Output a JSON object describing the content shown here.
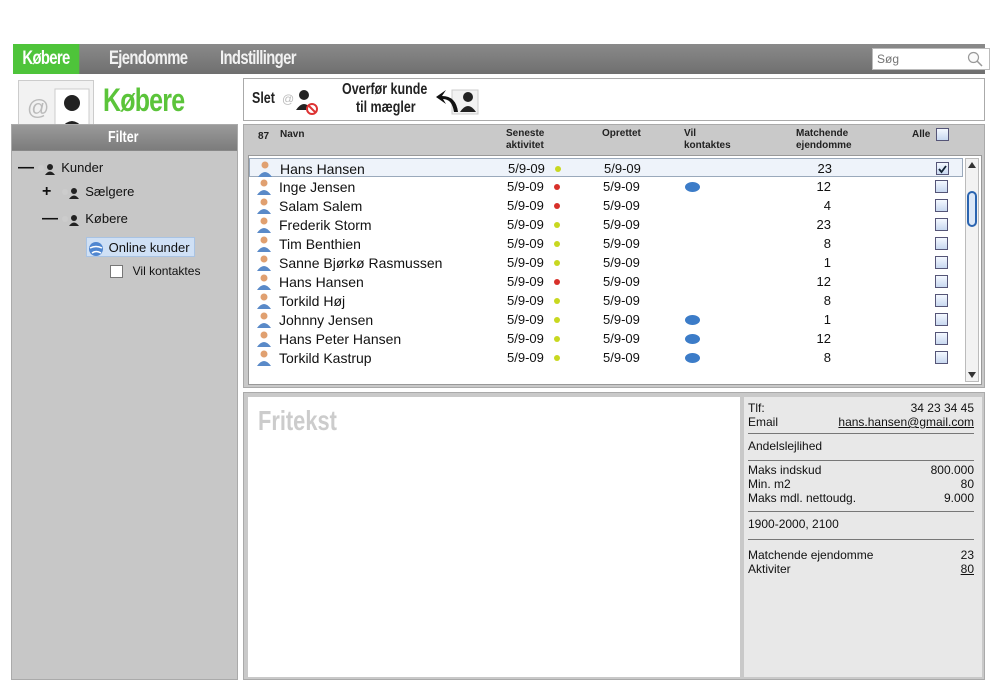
{
  "nav": {
    "tabs": [
      {
        "label": "Købere",
        "active": true
      },
      {
        "label": "Ejendomme",
        "active": false
      },
      {
        "label": "Indstillinger",
        "active": false
      }
    ],
    "search_placeholder": "Søg"
  },
  "page": {
    "title": "Købere"
  },
  "filter": {
    "title": "Filter",
    "tree": {
      "root": "Kunder",
      "sellers": "Sælgere",
      "buyers": "Købere",
      "online": "Online kunder",
      "contact": "Vil kontaktes"
    }
  },
  "toolbar": {
    "delete_label": "Slet",
    "transfer_line1": "Overfør kunde",
    "transfer_line2": "til mægler"
  },
  "grid": {
    "count": "87",
    "headers": {
      "name": "Navn",
      "latest1": "Seneste",
      "latest2": "aktivitet",
      "created": "Oprettet",
      "contact1": "Vil",
      "contact2": "kontaktes",
      "matching1": "Matchende",
      "matching2": "ejendomme",
      "all": "Alle"
    },
    "rows": [
      {
        "name": "Hans Hansen",
        "activity": "5/9-09",
        "status": "yellow",
        "created": "5/9-09",
        "contact": false,
        "matching": "23",
        "checked": true
      },
      {
        "name": "Inge Jensen",
        "activity": "5/9-09",
        "status": "red",
        "created": "5/9-09",
        "contact": true,
        "matching": "12",
        "checked": false
      },
      {
        "name": "Salam Salem",
        "activity": "5/9-09",
        "status": "red",
        "created": "5/9-09",
        "contact": false,
        "matching": "4",
        "checked": false
      },
      {
        "name": "Frederik Storm",
        "activity": "5/9-09",
        "status": "yellow",
        "created": "5/9-09",
        "contact": false,
        "matching": "23",
        "checked": false
      },
      {
        "name": "Tim Benthien",
        "activity": "5/9-09",
        "status": "yellow",
        "created": "5/9-09",
        "contact": false,
        "matching": "8",
        "checked": false
      },
      {
        "name": "Sanne Bjørkø Rasmussen",
        "activity": "5/9-09",
        "status": "yellow",
        "created": "5/9-09",
        "contact": false,
        "matching": "1",
        "checked": false
      },
      {
        "name": "Hans Hansen",
        "activity": "5/9-09",
        "status": "red",
        "created": "5/9-09",
        "contact": false,
        "matching": "12",
        "checked": false
      },
      {
        "name": "Torkild Høj",
        "activity": "5/9-09",
        "status": "yellow",
        "created": "5/9-09",
        "contact": false,
        "matching": "8",
        "checked": false
      },
      {
        "name": "Johnny Jensen",
        "activity": "5/9-09",
        "status": "yellow",
        "created": "5/9-09",
        "contact": true,
        "matching": "1",
        "checked": false
      },
      {
        "name": "Hans Peter Hansen",
        "activity": "5/9-09",
        "status": "yellow",
        "created": "5/9-09",
        "contact": true,
        "matching": "12",
        "checked": false
      },
      {
        "name": "Torkild Kastrup",
        "activity": "5/9-09",
        "status": "yellow",
        "created": "5/9-09",
        "contact": true,
        "matching": "8",
        "checked": false
      }
    ]
  },
  "detail": {
    "freetext_title": "Fritekst",
    "phone_label": "Tlf:",
    "phone": "34 23 34 45",
    "email_label": "Email",
    "email": "hans.hansen@gmail.com",
    "property_type": "Andelslejlihed",
    "max_price_label": "Maks indskud",
    "max_price": "800.000",
    "min_m2_label": "Min. m2",
    "min_m2": "80",
    "max_monthly_label": "Maks mdl. nettoudg.",
    "max_monthly": "9.000",
    "years": "1900-2000, 2100",
    "matching_label": "Matchende ejendomme",
    "matching": "23",
    "activities_label": "Aktiviter",
    "activities": "80"
  },
  "colors": {
    "accent": "#4ec43a",
    "status_yellow": "#c8d820",
    "status_red": "#d8302a",
    "chat_blue": "#3c7cc8"
  }
}
